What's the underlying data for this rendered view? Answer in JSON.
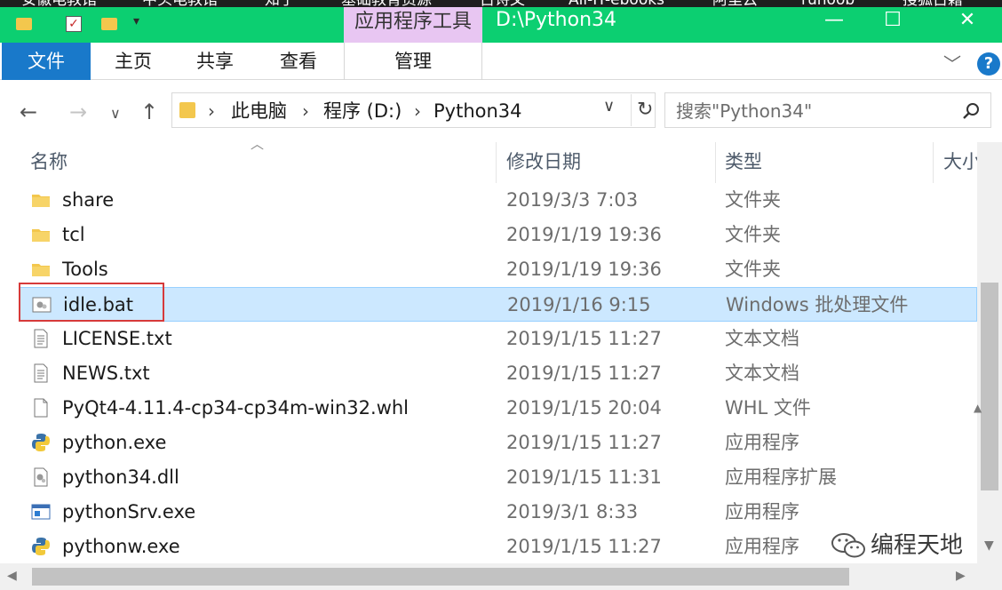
{
  "bookmarks": [
    "安徽电教馆",
    "中头电教馆",
    "知乎",
    "基础教育资源",
    "古诗文",
    "All-IT-ebooks",
    "阿里云",
    "runoob",
    "搜狐古籍"
  ],
  "window": {
    "context_tab": "应用程序工具",
    "title": "D:\\Python34",
    "minimize": "—",
    "maximize": "☐",
    "close": "✕"
  },
  "ribbon": {
    "tabs": [
      "文件",
      "主页",
      "共享",
      "查看",
      "管理"
    ],
    "help": "?"
  },
  "navigation": {
    "breadcrumb": [
      "此电脑",
      "程序 (D:)",
      "Python34"
    ],
    "search_placeholder": "搜索\"Python34\""
  },
  "columns": {
    "name": "名称",
    "date": "修改日期",
    "type": "类型",
    "size": "大小"
  },
  "files": [
    {
      "name": "share",
      "date": "2019/3/3 7:03",
      "type": "文件夹",
      "icon": "folder-icon"
    },
    {
      "name": "tcl",
      "date": "2019/1/19 19:36",
      "type": "文件夹",
      "icon": "folder-icon"
    },
    {
      "name": "Tools",
      "date": "2019/1/19 19:36",
      "type": "文件夹",
      "icon": "folder-icon"
    },
    {
      "name": "idle.bat",
      "date": "2019/1/16 9:15",
      "type": "Windows 批处理文件",
      "icon": "batch-file-icon",
      "selected": true
    },
    {
      "name": "LICENSE.txt",
      "date": "2019/1/15 11:27",
      "type": "文本文档",
      "icon": "text-file-icon"
    },
    {
      "name": "NEWS.txt",
      "date": "2019/1/15 11:27",
      "type": "文本文档",
      "icon": "text-file-icon"
    },
    {
      "name": "PyQt4-4.11.4-cp34-cp34m-win32.whl",
      "date": "2019/1/15 20:04",
      "type": "WHL 文件",
      "icon": "blank-file-icon"
    },
    {
      "name": "python.exe",
      "date": "2019/1/15 11:27",
      "type": "应用程序",
      "icon": "python-icon"
    },
    {
      "name": "python34.dll",
      "date": "2019/1/15 11:31",
      "type": "应用程序扩展",
      "icon": "dll-file-icon"
    },
    {
      "name": "pythonSrv.exe",
      "date": "2019/3/1 8:33",
      "type": "应用程序",
      "icon": "app-window-icon"
    },
    {
      "name": "pythonw.exe",
      "date": "2019/1/15 11:27",
      "type": "应用程序",
      "icon": "python-icon"
    }
  ],
  "watermark": {
    "text": "编程天地"
  },
  "colors": {
    "titlebar": "#0ccf71",
    "context_tab": "#e8c6f2",
    "file_tab": "#1979ca",
    "selection": "#cce8ff",
    "highlight_box": "#d63a3a"
  }
}
